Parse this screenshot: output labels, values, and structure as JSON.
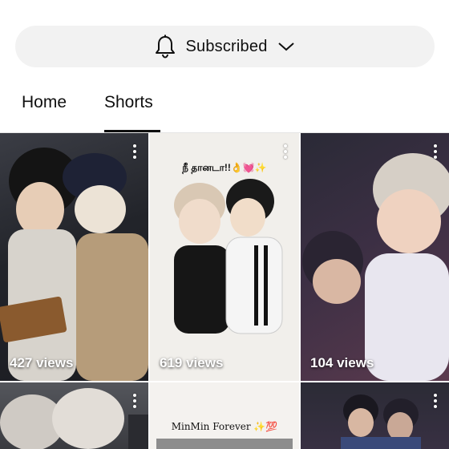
{
  "header": {
    "subscribe_button": {
      "label": "Subscribed",
      "icon": "bell-icon",
      "dropdown_icon": "chevron-down-icon"
    }
  },
  "tabs": [
    {
      "label": "Home",
      "selected": false
    },
    {
      "label": "Shorts",
      "selected": true
    }
  ],
  "shorts": [
    {
      "views": "427 views"
    },
    {
      "views": "619 views",
      "caption": "நீ தானடா!!👌💓✨"
    },
    {
      "views": "104 views"
    },
    {
      "views": ""
    },
    {
      "views": "",
      "caption": "MinMin Forever ✨💯"
    },
    {
      "views": ""
    }
  ],
  "colors": {
    "background": "#ffffff",
    "button_bg": "#f2f2f2",
    "text": "#0f0f0f",
    "views_text": "#ffffff"
  }
}
